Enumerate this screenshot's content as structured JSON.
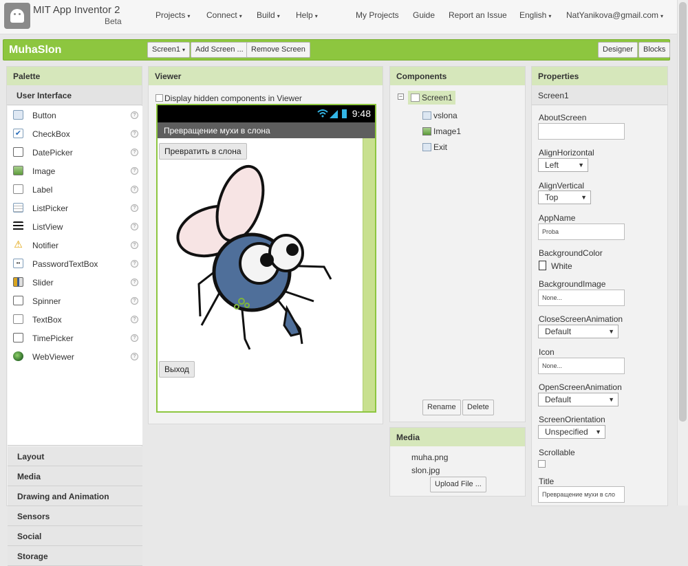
{
  "header": {
    "app_title": "MIT App Inventor 2",
    "app_subtitle": "Beta",
    "menus": [
      "Projects",
      "Connect",
      "Build",
      "Help"
    ],
    "links": [
      "My Projects",
      "Guide",
      "Report an Issue"
    ],
    "language": "English",
    "user": "NatYanikova@gmail.com"
  },
  "project": {
    "name": "MuhaSlon",
    "screen_select": "Screen1",
    "add_screen": "Add Screen ...",
    "remove_screen": "Remove Screen",
    "designer": "Designer",
    "blocks": "Blocks"
  },
  "palette": {
    "title": "Palette",
    "open_category": "User Interface",
    "help_glyph": "?",
    "items": [
      {
        "label": "Button",
        "icon": "button-icon"
      },
      {
        "label": "CheckBox",
        "icon": "checkbox-icon"
      },
      {
        "label": "DatePicker",
        "icon": "calendar-icon"
      },
      {
        "label": "Image",
        "icon": "image-icon"
      },
      {
        "label": "Label",
        "icon": "label-icon"
      },
      {
        "label": "ListPicker",
        "icon": "list-picker-icon"
      },
      {
        "label": "ListView",
        "icon": "list-view-icon"
      },
      {
        "label": "Notifier",
        "icon": "warning-icon"
      },
      {
        "label": "PasswordTextBox",
        "icon": "password-icon"
      },
      {
        "label": "Slider",
        "icon": "slider-icon"
      },
      {
        "label": "Spinner",
        "icon": "spinner-icon"
      },
      {
        "label": "TextBox",
        "icon": "textbox-icon"
      },
      {
        "label": "TimePicker",
        "icon": "clock-icon"
      },
      {
        "label": "WebViewer",
        "icon": "globe-icon"
      }
    ],
    "categories": [
      "Layout",
      "Media",
      "Drawing and Animation",
      "Sensors",
      "Social",
      "Storage"
    ]
  },
  "viewer": {
    "title": "Viewer",
    "hidden_checkbox": "Display hidden components in Viewer",
    "clock": "9:48",
    "screen_title": "Превращение мухи в слона",
    "button1": "Превратить в слона",
    "button2": "Выход"
  },
  "components": {
    "title": "Components",
    "toggle": "⊟",
    "tree": [
      "Screen1",
      "vslona",
      "Image1",
      "Exit"
    ],
    "rename": "Rename",
    "delete": "Delete"
  },
  "media": {
    "title": "Media",
    "files": [
      "muha.png",
      "slon.jpg"
    ],
    "upload": "Upload File ..."
  },
  "properties": {
    "title": "Properties",
    "component": "Screen1",
    "about_label": "AboutScreen",
    "about_value": "",
    "alignh_label": "AlignHorizontal",
    "alignh_value": "Left",
    "alignv_label": "AlignVertical",
    "alignv_value": "Top",
    "appname_label": "AppName",
    "appname_value": "Proba",
    "bgcolor_label": "BackgroundColor",
    "bgcolor_value": "White",
    "bgimage_label": "BackgroundImage",
    "bgimage_value": "None...",
    "close_anim_label": "CloseScreenAnimation",
    "close_anim_value": "Default",
    "icon_label": "Icon",
    "icon_value": "None...",
    "open_anim_label": "OpenScreenAnimation",
    "open_anim_value": "Default",
    "orientation_label": "ScreenOrientation",
    "orientation_value": "Unspecified",
    "scrollable_label": "Scrollable",
    "scrollable_checked": false,
    "title_label": "Title",
    "title_value": "Превращение мухи в сло"
  },
  "colors": {
    "accent_green": "#8dc63f",
    "panel_header": "#d6e7bb",
    "fly_body": "#4f6f9a",
    "fly_wing": "#f7e4e4"
  }
}
